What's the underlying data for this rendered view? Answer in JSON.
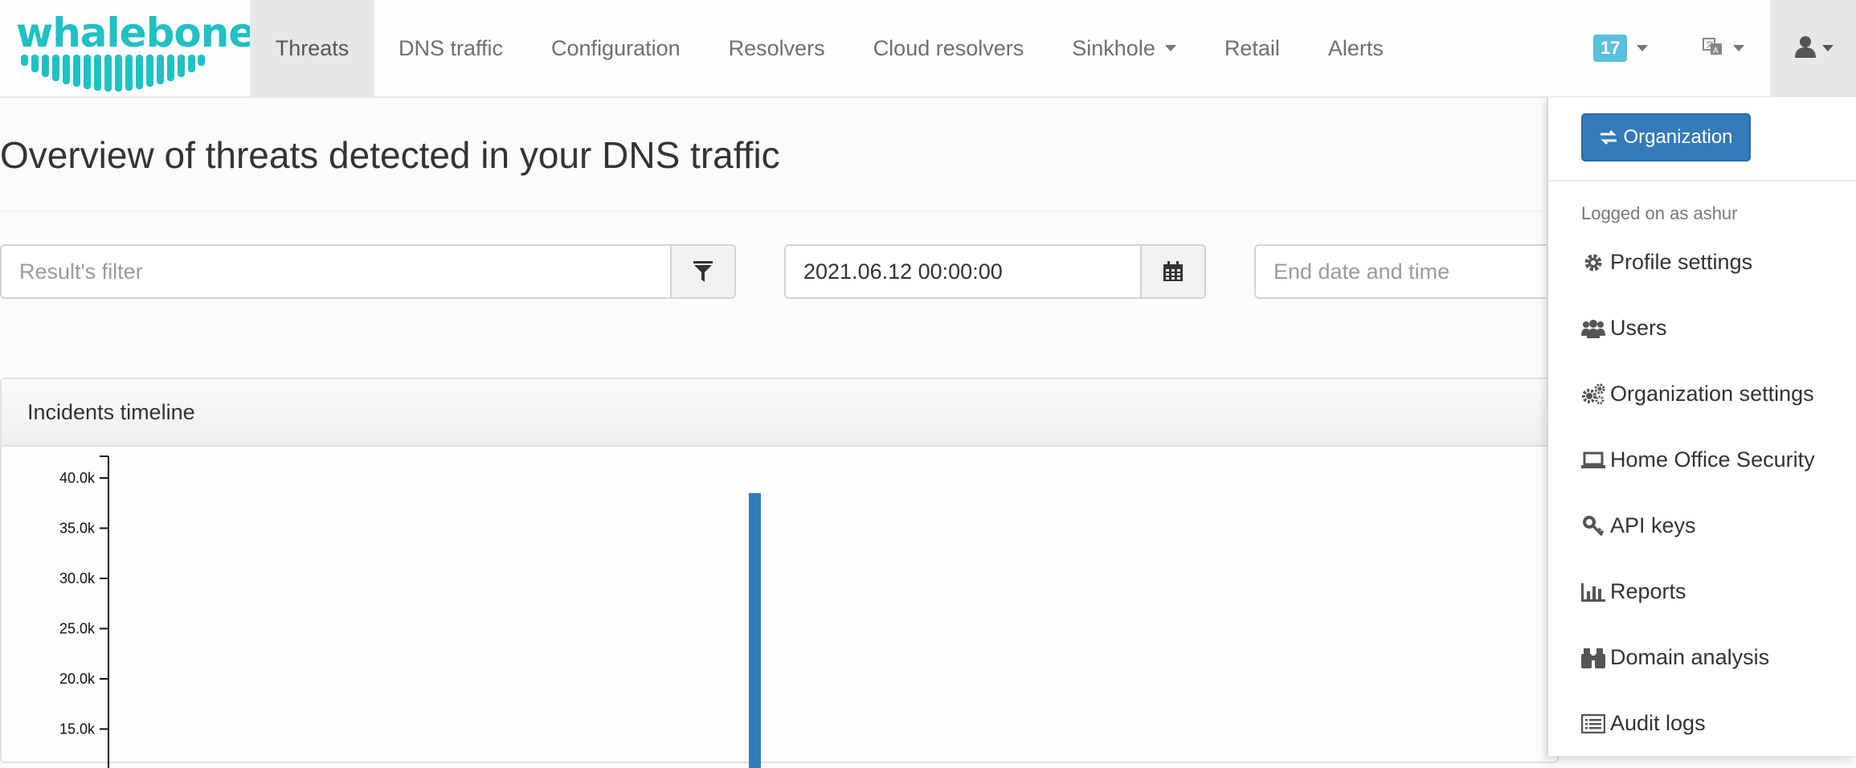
{
  "brand": {
    "logo_text": "whalebone",
    "color": "#1fc1c3"
  },
  "nav": {
    "items": [
      {
        "label": "Threats",
        "active": true
      },
      {
        "label": "DNS traffic"
      },
      {
        "label": "Configuration"
      },
      {
        "label": "Resolvers"
      },
      {
        "label": "Cloud resolvers"
      },
      {
        "label": "Sinkhole",
        "has_caret": true
      },
      {
        "label": "Retail"
      },
      {
        "label": "Alerts"
      }
    ],
    "notifications_count": "17",
    "language_icon": "language-icon",
    "user_icon": "user-icon"
  },
  "page": {
    "title": "Overview of threats detected in your DNS traffic"
  },
  "filters": {
    "result_filter": {
      "value": "",
      "placeholder": "Result's filter"
    },
    "start_date": {
      "value": "2021.06.12 00:00:00",
      "placeholder": ""
    },
    "end_date": {
      "value": "",
      "placeholder": "End date and time"
    }
  },
  "panel": {
    "title": "Incidents timeline"
  },
  "chart_data": {
    "type": "bar",
    "y_ticks": [
      "40.0k",
      "35.0k",
      "30.0k",
      "25.0k",
      "20.0k",
      "15.0k"
    ],
    "ylim": [
      15000,
      42000
    ],
    "series": [
      {
        "values": [
          38500
        ]
      }
    ],
    "bar_color": "#337ab7"
  },
  "user_menu": {
    "organization_button": "Organization",
    "logged_on_text": "Logged on as ashur",
    "items": [
      {
        "label": "Profile settings",
        "icon": "gear-icon"
      },
      {
        "label": "Users",
        "icon": "users-icon"
      },
      {
        "label": "Organization settings",
        "icon": "gears-icon"
      },
      {
        "label": "Home Office Security",
        "icon": "laptop-icon"
      },
      {
        "label": "API keys",
        "icon": "key-icon"
      },
      {
        "label": "Reports",
        "icon": "bar-chart-icon"
      },
      {
        "label": "Domain analysis",
        "icon": "binoculars-icon"
      },
      {
        "label": "Audit logs",
        "icon": "list-icon"
      }
    ]
  }
}
